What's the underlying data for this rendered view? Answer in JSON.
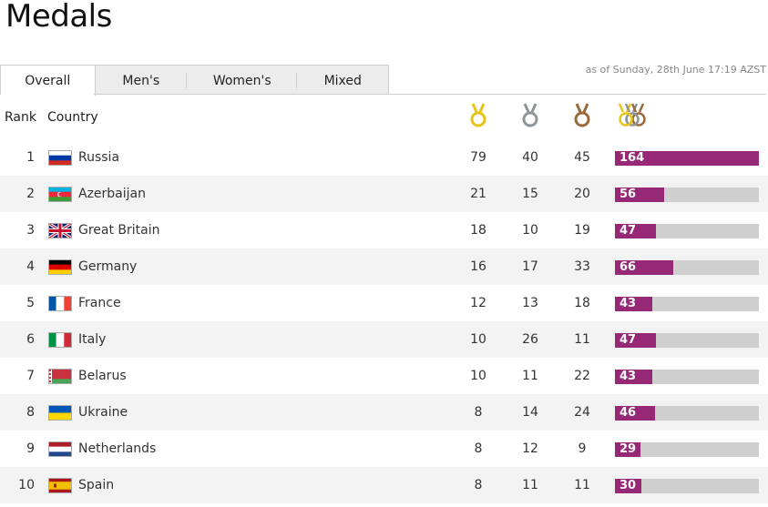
{
  "page": {
    "title": "Medals"
  },
  "tabs": [
    {
      "label": "Overall"
    },
    {
      "label": "Men's"
    },
    {
      "label": "Women's"
    },
    {
      "label": "Mixed"
    }
  ],
  "timestamp": "as of Sunday, 28th June 17:19 AZST",
  "header": {
    "rank": "Rank",
    "country": "Country"
  },
  "icons": {
    "gold": "gold-medal-icon",
    "silver": "silver-medal-icon",
    "bronze": "bronze-medal-icon",
    "total": "total-medals-icon"
  },
  "colors": {
    "bar_fill": "#962876",
    "bar_track": "#cfcfcf",
    "gold": "#e8c31a",
    "silver": "#8e9599",
    "bronze": "#9a6a3c",
    "row_alt": "#f3f3f3"
  },
  "bar_scale_max": 164,
  "rows": [
    {
      "rank": "1",
      "country": "Russia",
      "flag": "russia-flag-icon",
      "gold": "79",
      "silver": "40",
      "bronze": "45",
      "total": "164"
    },
    {
      "rank": "2",
      "country": "Azerbaijan",
      "flag": "azerbaijan-flag-icon",
      "gold": "21",
      "silver": "15",
      "bronze": "20",
      "total": "56"
    },
    {
      "rank": "3",
      "country": "Great Britain",
      "flag": "great-britain-flag-icon",
      "gold": "18",
      "silver": "10",
      "bronze": "19",
      "total": "47"
    },
    {
      "rank": "4",
      "country": "Germany",
      "flag": "germany-flag-icon",
      "gold": "16",
      "silver": "17",
      "bronze": "33",
      "total": "66"
    },
    {
      "rank": "5",
      "country": "France",
      "flag": "france-flag-icon",
      "gold": "12",
      "silver": "13",
      "bronze": "18",
      "total": "43"
    },
    {
      "rank": "6",
      "country": "Italy",
      "flag": "italy-flag-icon",
      "gold": "10",
      "silver": "26",
      "bronze": "11",
      "total": "47"
    },
    {
      "rank": "7",
      "country": "Belarus",
      "flag": "belarus-flag-icon",
      "gold": "10",
      "silver": "11",
      "bronze": "22",
      "total": "43"
    },
    {
      "rank": "8",
      "country": "Ukraine",
      "flag": "ukraine-flag-icon",
      "gold": "8",
      "silver": "14",
      "bronze": "24",
      "total": "46"
    },
    {
      "rank": "9",
      "country": "Netherlands",
      "flag": "netherlands-flag-icon",
      "gold": "8",
      "silver": "12",
      "bronze": "9",
      "total": "29"
    },
    {
      "rank": "10",
      "country": "Spain",
      "flag": "spain-flag-icon",
      "gold": "8",
      "silver": "11",
      "bronze": "11",
      "total": "30"
    }
  ]
}
